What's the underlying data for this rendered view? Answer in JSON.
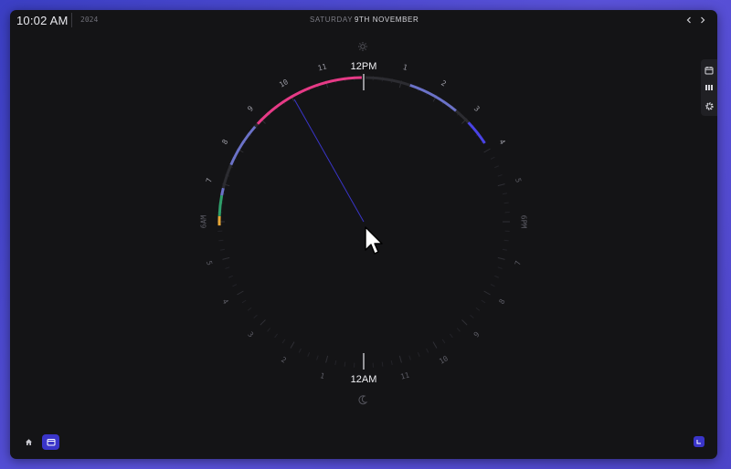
{
  "header": {
    "time": "10:02 AM",
    "year": "2024",
    "date_day": "SATURDAY",
    "date_rest": "9TH NOVEMBER",
    "prev_icon": "chevron-left-icon",
    "next_icon": "chevron-right-icon"
  },
  "clock": {
    "top_label": "12PM",
    "bottom_label": "12AM",
    "sun_icon": "sun-icon",
    "moon_icon": "moon-icon",
    "hour_labels": [
      {
        "text": "1",
        "hour": 13
      },
      {
        "text": "2",
        "hour": 14
      },
      {
        "text": "3",
        "hour": 15
      },
      {
        "text": "4",
        "hour": 16
      },
      {
        "text": "5",
        "hour": 17
      },
      {
        "text": "6PM",
        "hour": 18
      },
      {
        "text": "7",
        "hour": 19
      },
      {
        "text": "8",
        "hour": 20
      },
      {
        "text": "9",
        "hour": 21
      },
      {
        "text": "10",
        "hour": 22
      },
      {
        "text": "11",
        "hour": 23
      },
      {
        "text": "1",
        "hour": 1
      },
      {
        "text": "2",
        "hour": 2
      },
      {
        "text": "3",
        "hour": 3
      },
      {
        "text": "4",
        "hour": 4
      },
      {
        "text": "5",
        "hour": 5
      },
      {
        "text": "6AM",
        "hour": 6
      },
      {
        "text": "7",
        "hour": 7
      },
      {
        "text": "8",
        "hour": 8
      },
      {
        "text": "9",
        "hour": 9
      },
      {
        "text": "10",
        "hour": 10
      },
      {
        "text": "11",
        "hour": 11
      }
    ],
    "current_hour": 10.033,
    "hand_color": "#3a35c9",
    "segments": [
      {
        "start": 5.9,
        "end": 6.15,
        "color": "#e8a838"
      },
      {
        "start": 6.15,
        "end": 6.7,
        "color": "#2f9e6a"
      },
      {
        "start": 6.7,
        "end": 6.9,
        "color": "#6b72c8"
      },
      {
        "start": 6.9,
        "end": 7.55,
        "color": "#2c2c31"
      },
      {
        "start": 7.55,
        "end": 8.75,
        "color": "#6b72c8"
      },
      {
        "start": 8.75,
        "end": 8.85,
        "color": "#2c2c31"
      },
      {
        "start": 8.85,
        "end": 11.95,
        "color": "#e63a86"
      },
      {
        "start": 12.05,
        "end": 13.25,
        "color": "#2c2c31"
      },
      {
        "start": 13.25,
        "end": 14.65,
        "color": "#6b72c8"
      },
      {
        "start": 14.65,
        "end": 15.1,
        "color": "#2c2c31"
      },
      {
        "start": 15.1,
        "end": 15.8,
        "color": "#4a43e6"
      }
    ]
  },
  "sidebar_right": {
    "calendar_add_icon": "calendar-add-icon",
    "columns_icon": "columns-icon",
    "gear_icon": "gear-icon"
  },
  "bottom": {
    "home_icon": "home-icon",
    "calendar_icon": "calendar-icon",
    "corner_icon": "widget-icon"
  },
  "colors": {
    "accent": "#3a35c9",
    "window_bg": "#141416"
  }
}
